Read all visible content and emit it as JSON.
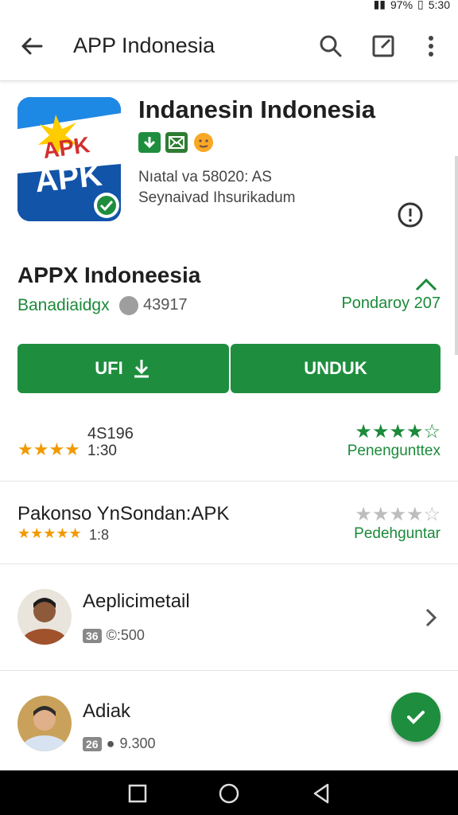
{
  "status_bar": {
    "battery": "97%",
    "time": "5:30"
  },
  "app_bar": {
    "title": "APP Indonesia",
    "icons": [
      "back-arrow-icon",
      "search-icon",
      "share-box-icon",
      "more-vert-icon"
    ]
  },
  "hero": {
    "title": "Indanesin Indonesia",
    "icon_text_top": "APK",
    "icon_text_bottom": "APK",
    "meta_line1": "Nıatal va 58020: AS",
    "meta_line2": "Seynaivad Ihsurikadum",
    "badge_icons": [
      "download-badge-icon",
      "mail-badge-icon",
      "emoji-badge-icon"
    ]
  },
  "app_info": {
    "name": "APPX Indoneesia",
    "developer": "Banadiaidgx",
    "downloads": "43917",
    "date": "Pondaroy 207"
  },
  "buttons": {
    "left_label": "UFI",
    "right_label": "UNDUK"
  },
  "rating_primary": {
    "count": "4S196",
    "sub": "1:30",
    "stars": "★★★★",
    "green_stars": "★★★★☆",
    "label": "Penengunttex"
  },
  "rating_secondary": {
    "title": "Pakonso YnSondan:APK",
    "stars": "★★★★★",
    "sub": "1:8",
    "grey_stars": "★★★★☆",
    "label": "Pedehguntar"
  },
  "people": [
    {
      "name": "Aeplicimetail",
      "tag": "36",
      "meta": "©:500"
    },
    {
      "name": "Adiak",
      "tag": "26",
      "meta": "9.300"
    }
  ],
  "colors": {
    "accent": "#1e8e3e",
    "star": "#f29900",
    "link": "#1b8a3a"
  },
  "nav_bar": {
    "icons": [
      "recent-square-icon",
      "home-circle-icon",
      "back-triangle-icon"
    ]
  }
}
